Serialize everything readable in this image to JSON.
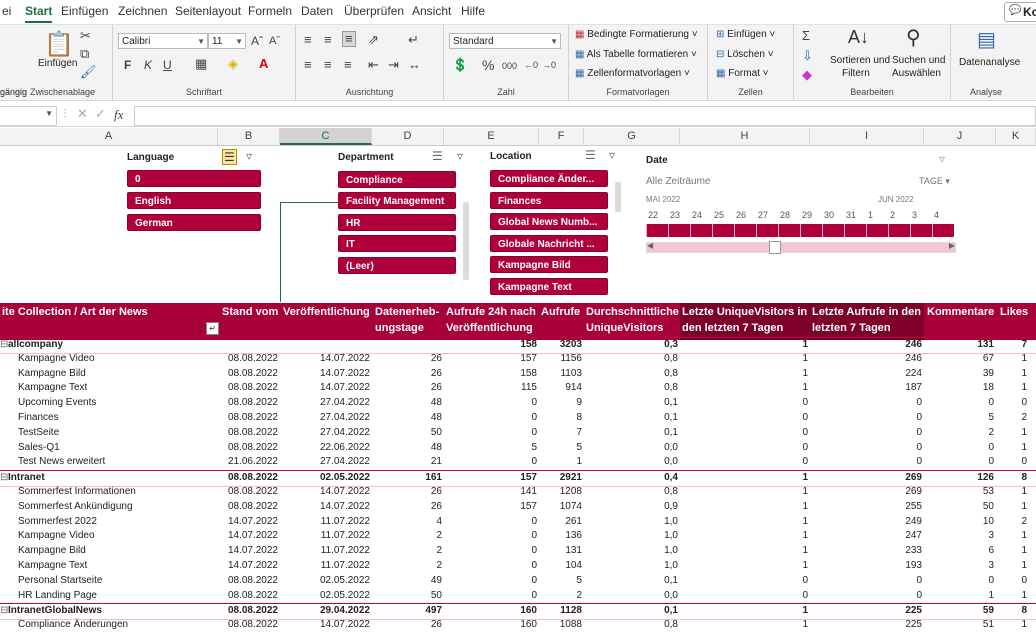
{
  "ribbon": {
    "tabs": [
      "ei",
      "Start",
      "Einfügen",
      "Zeichnen",
      "Seitenlayout",
      "Formeln",
      "Daten",
      "Überprüfen",
      "Ansicht",
      "Hilfe"
    ],
    "active_tab": "Start",
    "share_label": "Ko",
    "groups": {
      "clipboard": {
        "label": "Zwischenablage",
        "paste": "Einfügen",
        "left_cut": "gängig"
      },
      "font": {
        "label": "Schriftart",
        "font_name": "Calibri",
        "font_size": "11",
        "bold": "F",
        "italic": "K",
        "underline": "U"
      },
      "alignment": {
        "label": "Ausrichtung"
      },
      "number": {
        "label": "Zahl",
        "format": "Standard"
      },
      "styles": {
        "label": "Formatvorlagen",
        "conditional": "Bedingte Formatierung",
        "as_table": "Als Tabelle formatieren",
        "cell_styles": "Zellenformatvorlagen"
      },
      "cells": {
        "label": "Zellen",
        "insert": "Einfügen",
        "delete": "Löschen",
        "format": "Format"
      },
      "editing": {
        "label": "Bearbeiten",
        "sort": "Sortieren und",
        "sort2": "Filtern",
        "find": "Suchen und",
        "find2": "Auswählen"
      },
      "analysis": {
        "label": "Analyse",
        "analyze": "Datenanalyse"
      }
    }
  },
  "formula_bar": {
    "fx": "fx"
  },
  "columns": [
    "A",
    "B",
    "C",
    "D",
    "E",
    "F",
    "G",
    "H",
    "I",
    "J",
    "K"
  ],
  "selected_column": "C",
  "slicers": {
    "language": {
      "title": "Language",
      "items": [
        "0",
        "English",
        "German"
      ]
    },
    "department": {
      "title": "Department",
      "items": [
        "Compliance",
        "Facility Management",
        "HR",
        "IT",
        "(Leer)"
      ]
    },
    "location": {
      "title": "Location",
      "items": [
        "Compliance Änder...",
        "Finances",
        "Global News Numb...",
        "Globale Nachricht ...",
        "Kampagne Bild",
        "Kampagne Text"
      ]
    },
    "date": {
      "title": "Date",
      "all_periods": "Alle Zeiträume",
      "level": "TAGE",
      "month1": "MAI 2022",
      "month2": "JUN 2022",
      "days": [
        "22",
        "23",
        "24",
        "25",
        "26",
        "27",
        "28",
        "29",
        "30",
        "31",
        "1",
        "2",
        "3",
        "4"
      ]
    }
  },
  "pivot": {
    "headers": {
      "site": "ite Collection / Art der News",
      "stand": "Stand vom",
      "veroeff": "Veröffentlichung",
      "daten1": "Datenerheb-",
      "daten2": "ungstage",
      "aufrufe24_1": "Aufrufe 24h nach",
      "aufrufe24_2": "Veröffentlichung",
      "aufrufe": "Aufrufe",
      "durch1": "Durchschnittliche",
      "durch2": "UniqueVisitors",
      "letzteUV1": "Letzte UniqueVisitors in",
      "letzteUV2": "den letzten 7 Tagen",
      "letzteA1": "Letzte Aufrufe in den",
      "letzteA2": "letzten 7 Tagen",
      "komm": "Kommentare",
      "likes": "Likes"
    },
    "rows": [
      {
        "g": true,
        "name": "allcompany",
        "stand": "",
        "veroeff": "",
        "tage": "",
        "a24": "158",
        "aufrufe": "3203",
        "durch": "0,3",
        "uv7": "1",
        "a7": "246",
        "komm": "131",
        "likes": "7"
      },
      {
        "g": false,
        "name": "Kampagne Video",
        "stand": "08.08.2022",
        "veroeff": "14.07.2022",
        "tage": "26",
        "a24": "157",
        "aufrufe": "1156",
        "durch": "0,8",
        "uv7": "1",
        "a7": "246",
        "komm": "67",
        "likes": "1"
      },
      {
        "g": false,
        "name": "Kampagne Bild",
        "stand": "08.08.2022",
        "veroeff": "14.07.2022",
        "tage": "26",
        "a24": "158",
        "aufrufe": "1103",
        "durch": "0,8",
        "uv7": "1",
        "a7": "224",
        "komm": "39",
        "likes": "1"
      },
      {
        "g": false,
        "name": "Kampagne Text",
        "stand": "08.08.2022",
        "veroeff": "14.07.2022",
        "tage": "26",
        "a24": "115",
        "aufrufe": "914",
        "durch": "0,8",
        "uv7": "1",
        "a7": "187",
        "komm": "18",
        "likes": "1"
      },
      {
        "g": false,
        "name": "Upcoming Events",
        "stand": "08.08.2022",
        "veroeff": "27.04.2022",
        "tage": "48",
        "a24": "0",
        "aufrufe": "9",
        "durch": "0,1",
        "uv7": "0",
        "a7": "0",
        "komm": "0",
        "likes": "0"
      },
      {
        "g": false,
        "name": "Finances",
        "stand": "08.08.2022",
        "veroeff": "27.04.2022",
        "tage": "48",
        "a24": "0",
        "aufrufe": "8",
        "durch": "0,1",
        "uv7": "0",
        "a7": "0",
        "komm": "5",
        "likes": "2"
      },
      {
        "g": false,
        "name": "TestSeite",
        "stand": "08.08.2022",
        "veroeff": "27.04.2022",
        "tage": "50",
        "a24": "0",
        "aufrufe": "7",
        "durch": "0,1",
        "uv7": "0",
        "a7": "0",
        "komm": "2",
        "likes": "1"
      },
      {
        "g": false,
        "name": "Sales-Q1",
        "stand": "08.08.2022",
        "veroeff": "22.06.2022",
        "tage": "48",
        "a24": "5",
        "aufrufe": "5",
        "durch": "0,0",
        "uv7": "0",
        "a7": "0",
        "komm": "0",
        "likes": "1"
      },
      {
        "g": false,
        "name": "Test News erweitert",
        "stand": "21.06.2022",
        "veroeff": "27.04.2022",
        "tage": "21",
        "a24": "0",
        "aufrufe": "1",
        "durch": "0,0",
        "uv7": "0",
        "a7": "0",
        "komm": "0",
        "likes": "0"
      },
      {
        "g": true,
        "name": "Intranet",
        "stand": "08.08.2022",
        "veroeff": "02.05.2022",
        "tage": "161",
        "a24": "157",
        "aufrufe": "2921",
        "durch": "0,4",
        "uv7": "1",
        "a7": "269",
        "komm": "126",
        "likes": "8"
      },
      {
        "g": false,
        "name": "Sommerfest Informationen",
        "stand": "08.08.2022",
        "veroeff": "14.07.2022",
        "tage": "26",
        "a24": "141",
        "aufrufe": "1208",
        "durch": "0,8",
        "uv7": "1",
        "a7": "269",
        "komm": "53",
        "likes": "1"
      },
      {
        "g": false,
        "name": "Sommerfest Ankündigung",
        "stand": "08.08.2022",
        "veroeff": "14.07.2022",
        "tage": "26",
        "a24": "157",
        "aufrufe": "1074",
        "durch": "0,9",
        "uv7": "1",
        "a7": "255",
        "komm": "50",
        "likes": "1"
      },
      {
        "g": false,
        "name": "Sommerfest 2022",
        "stand": "14.07.2022",
        "veroeff": "11.07.2022",
        "tage": "4",
        "a24": "0",
        "aufrufe": "261",
        "durch": "1,0",
        "uv7": "1",
        "a7": "249",
        "komm": "10",
        "likes": "2"
      },
      {
        "g": false,
        "name": "Kampagne Video",
        "stand": "14.07.2022",
        "veroeff": "11.07.2022",
        "tage": "2",
        "a24": "0",
        "aufrufe": "136",
        "durch": "1,0",
        "uv7": "1",
        "a7": "247",
        "komm": "3",
        "likes": "1"
      },
      {
        "g": false,
        "name": "Kampagne Bild",
        "stand": "14.07.2022",
        "veroeff": "11.07.2022",
        "tage": "2",
        "a24": "0",
        "aufrufe": "131",
        "durch": "1,0",
        "uv7": "1",
        "a7": "233",
        "komm": "6",
        "likes": "1"
      },
      {
        "g": false,
        "name": "Kampagne Text",
        "stand": "14.07.2022",
        "veroeff": "11.07.2022",
        "tage": "2",
        "a24": "0",
        "aufrufe": "104",
        "durch": "1,0",
        "uv7": "1",
        "a7": "193",
        "komm": "3",
        "likes": "1"
      },
      {
        "g": false,
        "name": "Personal Startseite",
        "stand": "08.08.2022",
        "veroeff": "02.05.2022",
        "tage": "49",
        "a24": "0",
        "aufrufe": "5",
        "durch": "0,1",
        "uv7": "0",
        "a7": "0",
        "komm": "0",
        "likes": "0"
      },
      {
        "g": false,
        "name": "HR Landing Page",
        "stand": "08.08.2022",
        "veroeff": "02.05.2022",
        "tage": "50",
        "a24": "0",
        "aufrufe": "2",
        "durch": "0,0",
        "uv7": "0",
        "a7": "0",
        "komm": "1",
        "likes": "1"
      },
      {
        "g": true,
        "name": "IntranetGlobalNews",
        "stand": "08.08.2022",
        "veroeff": "29.04.2022",
        "tage": "497",
        "a24": "160",
        "aufrufe": "1128",
        "durch": "0,1",
        "uv7": "1",
        "a7": "225",
        "komm": "59",
        "likes": "8"
      },
      {
        "g": false,
        "name": "Compliance Änderungen",
        "stand": "08.08.2022",
        "veroeff": "14.07.2022",
        "tage": "26",
        "a24": "160",
        "aufrufe": "1088",
        "durch": "0,8",
        "uv7": "1",
        "a7": "225",
        "komm": "51",
        "likes": "1"
      }
    ]
  }
}
